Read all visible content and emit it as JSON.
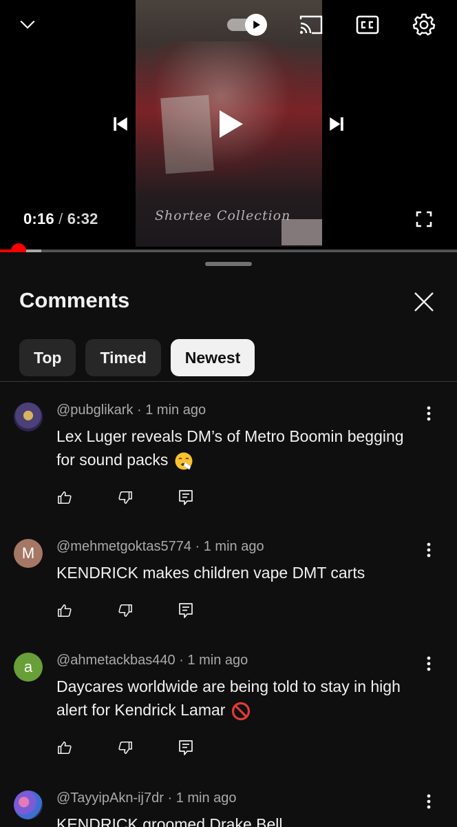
{
  "player": {
    "current_time": "0:16",
    "separator": " / ",
    "total_time": "6:32",
    "progress_fraction": 0.041,
    "buffered_fraction": 0.09,
    "watermark": "Shortee Collection",
    "icons": {
      "collapse": "chevron-down-icon",
      "autoplay": "autoplay-toggle-icon",
      "cast": "cast-icon",
      "captions": "closed-captions-icon",
      "settings": "gear-icon",
      "previous": "skip-previous-icon",
      "play": "play-icon",
      "next": "skip-next-icon",
      "fullscreen": "fullscreen-icon"
    },
    "accent_color": "#ff0000"
  },
  "comments_panel": {
    "title": "Comments",
    "close_icon": "close-icon",
    "filters": [
      {
        "label": "Top",
        "active": false
      },
      {
        "label": "Timed",
        "active": false
      },
      {
        "label": "Newest",
        "active": true
      }
    ],
    "comments": [
      {
        "author": "@pubglikark",
        "time": "1 min ago",
        "text": "Lex Luger reveals DM’s of Metro Boomin begging for sound packs",
        "emoji": "sneezing-face",
        "avatar_type": "image"
      },
      {
        "author": "@mehmetgoktas5774",
        "time": "1 min ago",
        "text": "KENDRICK makes children vape DMT carts",
        "avatar_letter": "M",
        "avatar_color": "#a57764"
      },
      {
        "author": "@ahmetackbas440",
        "time": "1 min ago",
        "text": "Daycares worldwide are being told to stay in high alert for Kendrick Lamar",
        "emoji": "prohibited",
        "avatar_letter": "a",
        "avatar_color": "#689f38"
      },
      {
        "author": "@TayyipAkn-ij7dr",
        "time": "1 min ago",
        "text": "KENDRICK groomed Drake Bell",
        "avatar_type": "image"
      }
    ],
    "action_icons": [
      "thumbs-up-icon",
      "thumbs-down-icon",
      "reply-icon"
    ]
  }
}
